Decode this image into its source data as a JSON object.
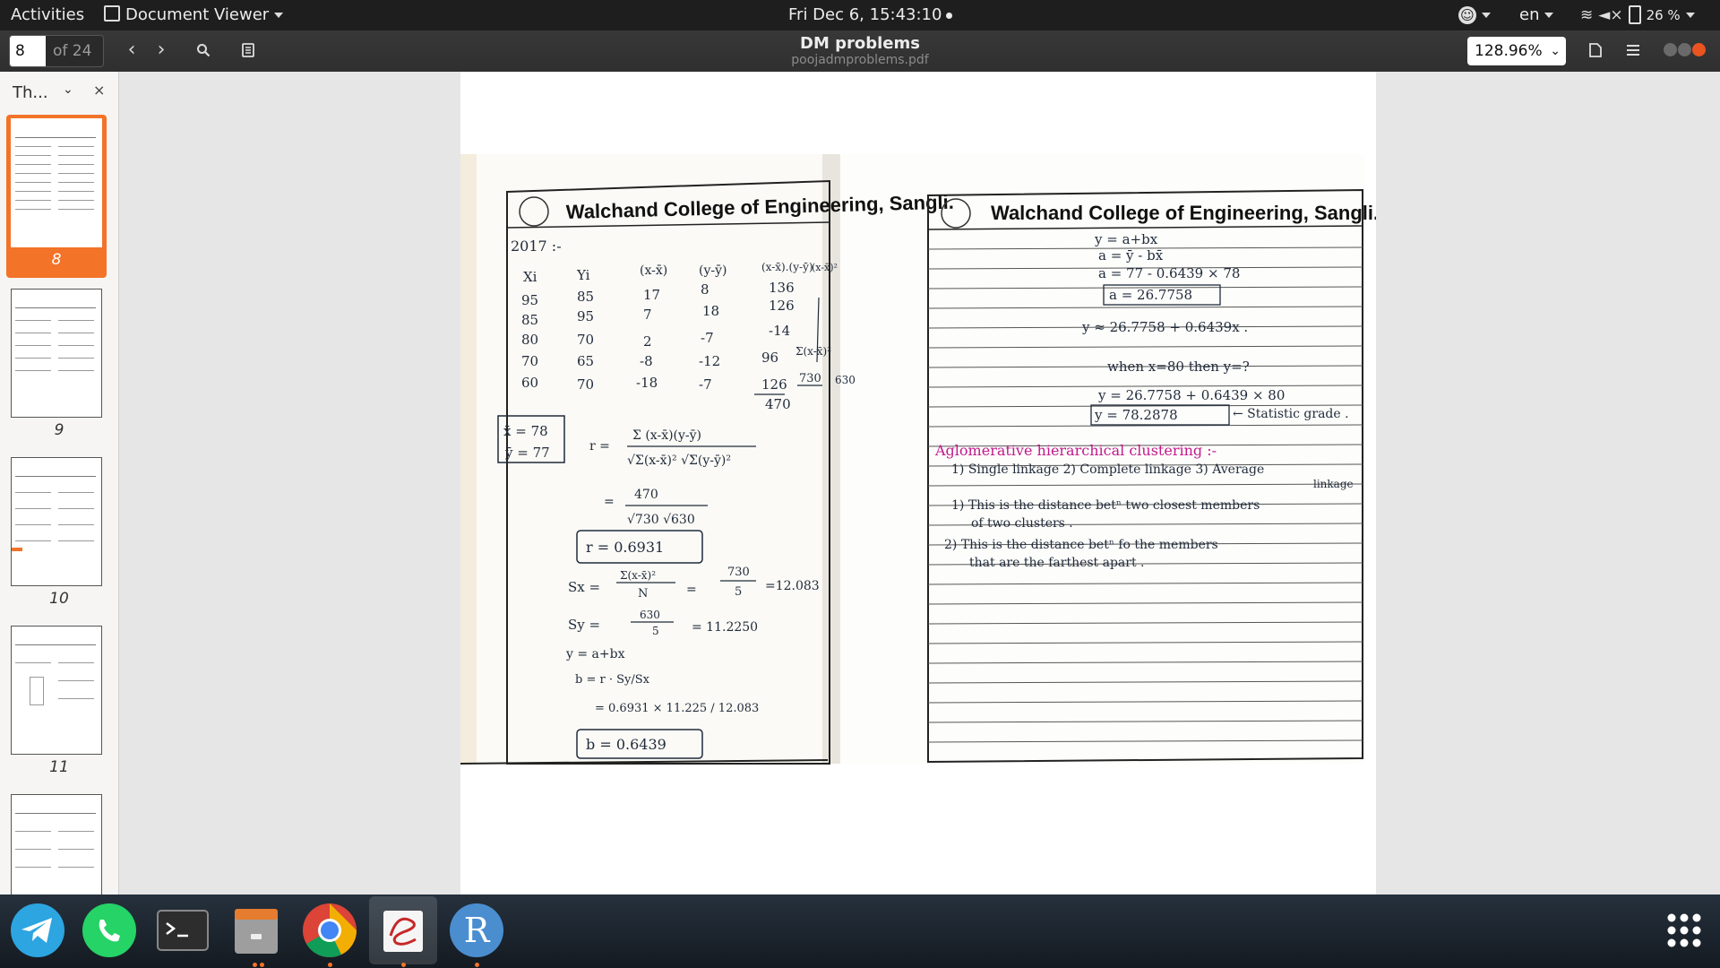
{
  "topbar": {
    "activities": "Activities",
    "app_menu": "Document Viewer",
    "clock": "Fri Dec  6, 15:43:10",
    "language": "en",
    "battery": "26 %"
  },
  "header": {
    "page_value": "8",
    "page_total": "of 24",
    "title": "DM problems",
    "subtitle": "poojadmproblems.pdf",
    "zoom": "128.96%"
  },
  "sidebar": {
    "mode_label": "Th...",
    "thumbnails": [
      {
        "label": "8",
        "selected": true
      },
      {
        "label": "9",
        "selected": false
      },
      {
        "label": "10",
        "selected": false
      },
      {
        "label": "11",
        "selected": false
      }
    ]
  },
  "scan": {
    "left_header": "Walchand College of Engineering, Sangli.",
    "right_header": "Walchand College of Engineering, Sangli.",
    "left": {
      "year": "2017 :-",
      "col_x": "Xi",
      "col_y": "Yi",
      "col_dx": "(x-x̄)",
      "col_dy": "(y-ȳ)",
      "col_prod": "(x-x̄).(y-ȳ)",
      "col_sq": "(x-x̄)²",
      "col_sq2": "(y-ȳ",
      "rows": [
        [
          "95",
          "85",
          "17",
          "8",
          "136"
        ],
        [
          "85",
          "95",
          "7",
          "18",
          "126"
        ],
        [
          "80",
          "70",
          "2",
          "-7",
          "-14"
        ],
        [
          "70",
          "65",
          "-8",
          "-12",
          "96"
        ],
        [
          "60",
          "70",
          "-18",
          "-7",
          "126"
        ]
      ],
      "prod_sum": "470",
      "sum_label": "Σ(x-x̄)²",
      "sum_label2": "Σ(y-",
      "sq_sum": "730",
      "sq_sum2": "630",
      "mean_x": "x̄ = 78",
      "mean_y": "ȳ = 77",
      "r_label": "r =",
      "r_num": "Σ (x-x̄)(y-ȳ)",
      "r_den": "√Σ(x-x̄)²  √Σ(y-ȳ)²",
      "r_eq": "=",
      "r_num2": "470",
      "r_den2": "√730 √630",
      "r_value": "r =  0.6931",
      "sx_label": "Sx =",
      "sx_frac": "Σ(x-x̄)²",
      "sx_n": "N",
      "sx_eq": "=",
      "sx_frac2": "730",
      "sx_n2": "5",
      "sx_value": "=12.083",
      "sy_label": "Sy =",
      "sy_frac": "630",
      "sy_n": "5",
      "sy_value": "=  11.2250",
      "reg": "y = a+bx",
      "b_formula": "b = r · Sy/Sx",
      "b_calc": "=  0.6931 × 11.225 / 12.083",
      "b_value": "b =  0.6439"
    },
    "right": {
      "l1": "y = a+bx",
      "l2": "a = ȳ - bx̄",
      "l3": "a =  77 - 0.6439 × 78",
      "l4": "a =  26.7758",
      "l5": "y ≈ 26.7758 + 0.6439x .",
      "l6": "when  x=80  then  y=?",
      "l7": "y = 26.7758 + 0.6439 × 80",
      "l8": "y =  78.2878",
      "l8b": "← Statistic grade .",
      "l9": "Aglomerative hierarchical clustering :-",
      "l10": "1) Single linkage   2) Complete linkage 3) Average",
      "l10b": "linkage",
      "l11": "1) This is  the distance betⁿ two closest members",
      "l12": "of  two  clusters .",
      "l13": "2)  This  is  the  distance  betⁿ  fo the members",
      "l14": "that  are  the  farthest  apart ."
    }
  },
  "dock": {
    "apps": [
      "telegram-icon",
      "whatsapp-icon",
      "terminal-icon",
      "files-icon",
      "chrome-icon",
      "document-viewer-icon",
      "r-icon"
    ],
    "r_letter": "R"
  },
  "colors": {
    "accent": "#f37329",
    "topbar": "#1e1e1e",
    "header": "#333333",
    "ink": "#1f2a3a",
    "pink_ink": "#c2188c"
  }
}
